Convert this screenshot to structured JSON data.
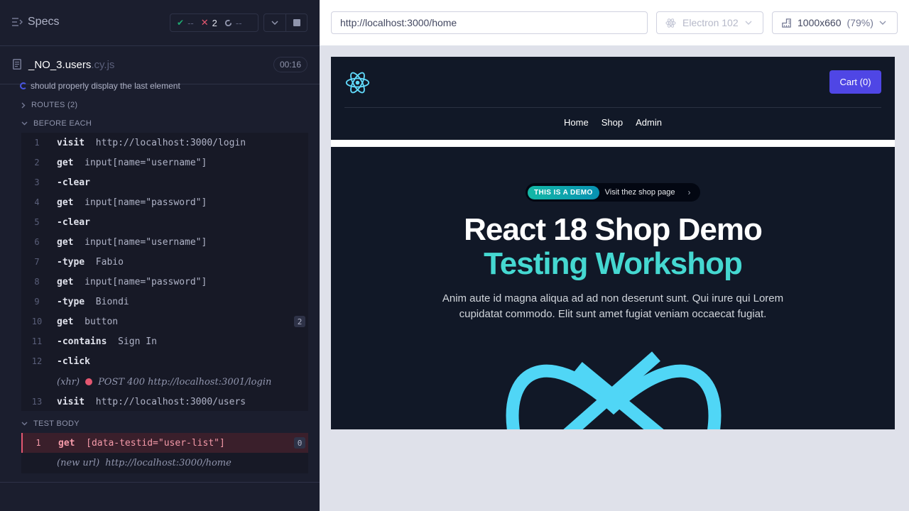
{
  "reporter": {
    "specs_label": "Specs",
    "stats": {
      "passed": "--",
      "failed": "2",
      "pending": "--"
    },
    "spec": {
      "name": "_NO_3.users",
      "ext": ".cy.js",
      "duration": "00:16"
    },
    "test_title": "should properly display the last element",
    "routes_label": "ROUTES (2)",
    "before_each_label": "BEFORE EACH",
    "test_body_label": "TEST BODY",
    "before_each": [
      {
        "num": "1",
        "name": "visit",
        "arg": "http://localhost:3000/login"
      },
      {
        "num": "2",
        "name": "get",
        "arg": "input[name=\"username\"]"
      },
      {
        "num": "3",
        "name": "-clear",
        "arg": ""
      },
      {
        "num": "4",
        "name": "get",
        "arg": "input[name=\"password\"]"
      },
      {
        "num": "5",
        "name": "-clear",
        "arg": ""
      },
      {
        "num": "6",
        "name": "get",
        "arg": "input[name=\"username\"]"
      },
      {
        "num": "7",
        "name": "-type",
        "arg": "Fabio"
      },
      {
        "num": "8",
        "name": "get",
        "arg": "input[name=\"password\"]"
      },
      {
        "num": "9",
        "name": "-type",
        "arg": "Biondi"
      },
      {
        "num": "10",
        "name": "get",
        "arg": "button",
        "badge": "2"
      },
      {
        "num": "11",
        "name": "-contains",
        "arg": "Sign In"
      },
      {
        "num": "12",
        "name": "-click",
        "arg": ""
      }
    ],
    "xhr_event": {
      "type": "(xhr)",
      "text": "POST 400 http://localhost:3001/login"
    },
    "cmd13": {
      "num": "13",
      "name": "visit",
      "arg": "http://localhost:3000/users"
    },
    "test_body": {
      "num": "1",
      "name": "get",
      "arg": "[data-testid=\"user-list\"]",
      "badge": "0"
    },
    "new_url_event": {
      "type": "(new url)",
      "text": "http://localhost:3000/home"
    }
  },
  "aut": {
    "url": "http://localhost:3000/home",
    "browser": "Electron 102",
    "viewport": "1000x660",
    "scale": "(79%)"
  },
  "app": {
    "cart_label": "Cart (0)",
    "nav": [
      "Home",
      "Shop",
      "Admin"
    ],
    "demo_tag": "THIS IS A DEMO",
    "demo_link": "Visit thez shop page",
    "title_line1": "React 18 Shop Demo",
    "title_line2": "Testing Workshop",
    "description": "Anim aute id magna aliqua ad ad non deserunt sunt. Qui irure qui Lorem cupidatat commodo. Elit sunt amet fugiat veniam occaecat fugiat."
  },
  "colors": {
    "accent": "#4f46e5",
    "fail": "#e45770",
    "teal": "#45d8d1",
    "react": "#61dafb"
  }
}
